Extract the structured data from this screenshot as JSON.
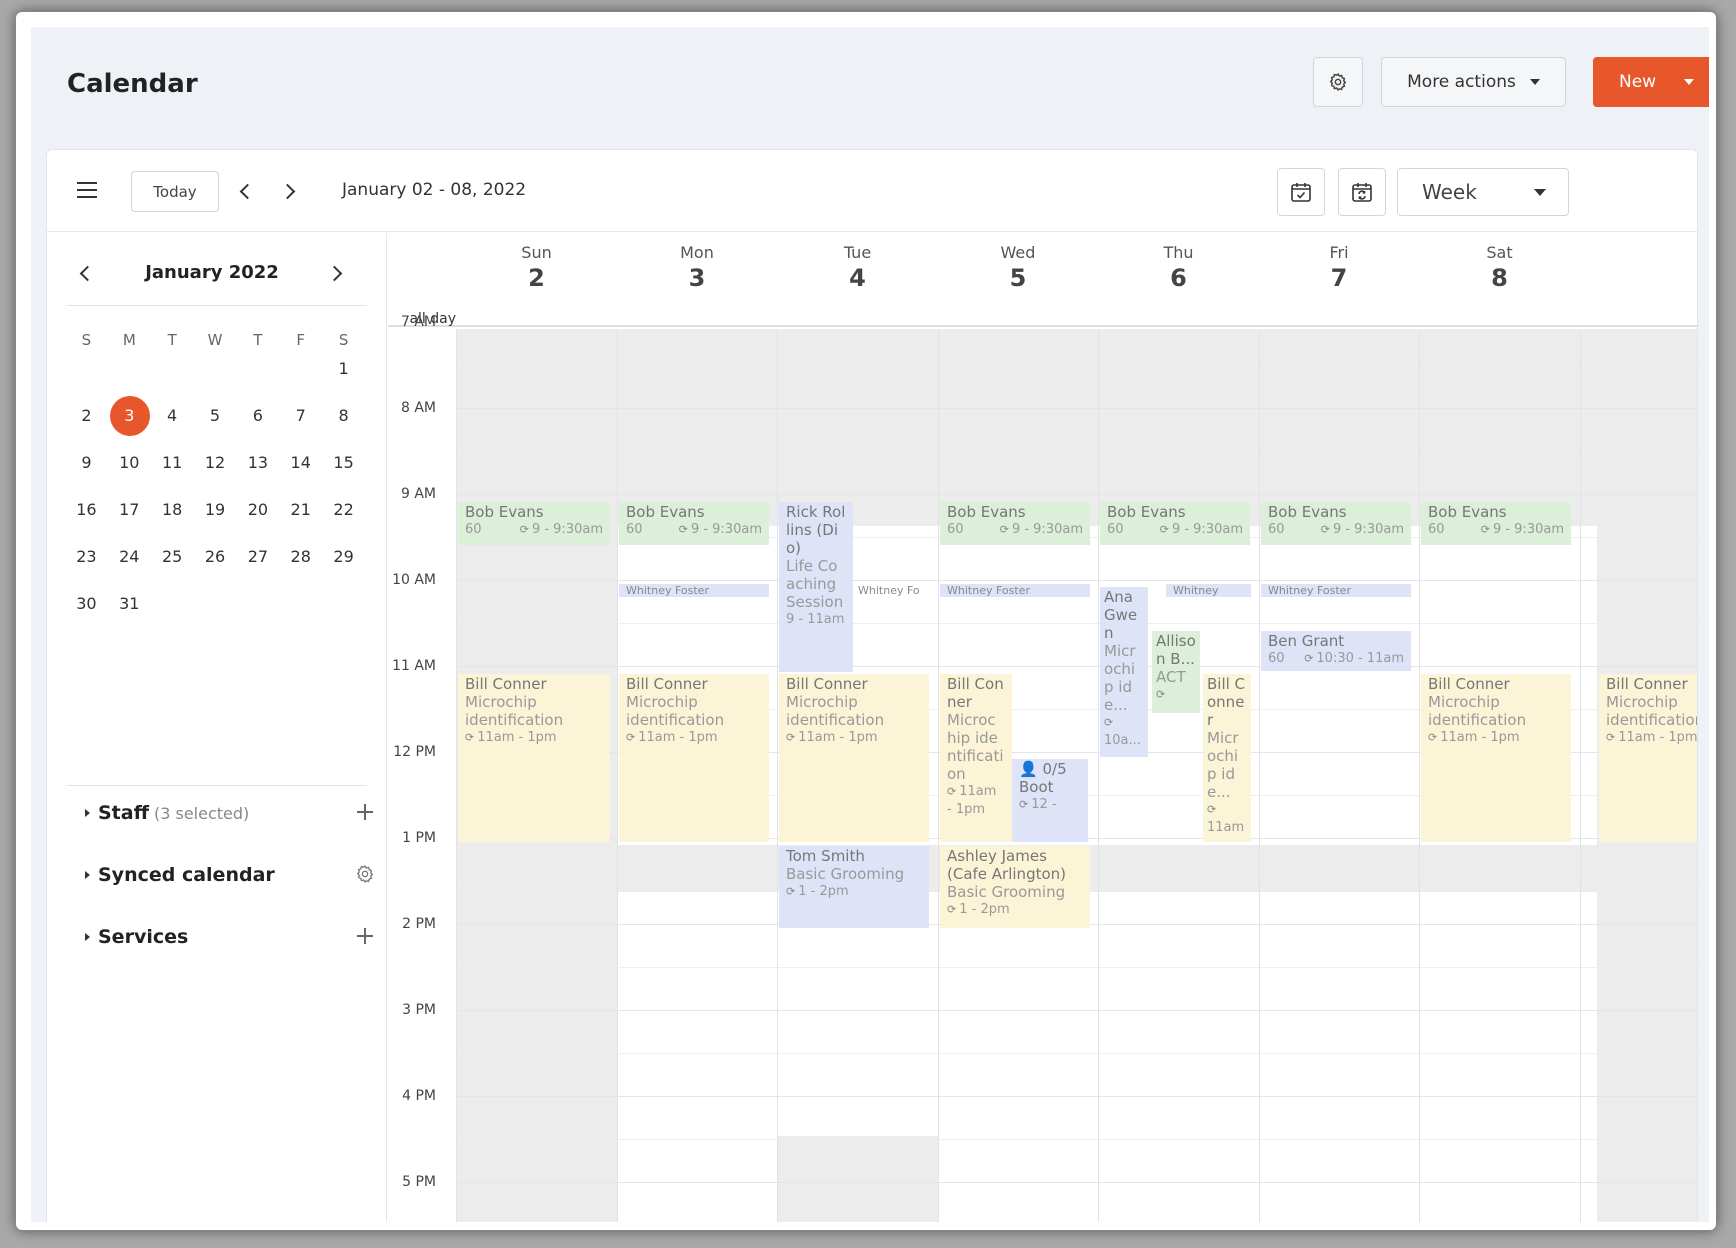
{
  "header": {
    "title": "Calendar",
    "more_actions_label": "More actions",
    "new_label": "New"
  },
  "toolbar": {
    "today_label": "Today",
    "range": "January 02 - 08, 2022",
    "view_label": "Week"
  },
  "mini_calendar": {
    "title": "January 2022",
    "weekdays": [
      "S",
      "M",
      "T",
      "W",
      "T",
      "F",
      "S"
    ],
    "weeks": [
      [
        "",
        "",
        "",
        "",
        "",
        "",
        "1"
      ],
      [
        "2",
        "3",
        "4",
        "5",
        "6",
        "7",
        "8"
      ],
      [
        "9",
        "10",
        "11",
        "12",
        "13",
        "14",
        "15"
      ],
      [
        "16",
        "17",
        "18",
        "19",
        "20",
        "21",
        "22"
      ],
      [
        "23",
        "24",
        "25",
        "26",
        "27",
        "28",
        "29"
      ],
      [
        "30",
        "31",
        "",
        "",
        "",
        "",
        ""
      ]
    ],
    "selected_day": "3"
  },
  "sidebar": {
    "sections": [
      {
        "name": "Staff",
        "sub": "(3 selected)",
        "action": "plus-icon"
      },
      {
        "name": "Synced calendar",
        "sub": "",
        "action": "gear-icon"
      },
      {
        "name": "Services",
        "sub": "",
        "action": "plus-icon"
      }
    ]
  },
  "week": {
    "all_day_label": "all day",
    "days": [
      {
        "name": "Sun",
        "date": "2"
      },
      {
        "name": "Mon",
        "date": "3"
      },
      {
        "name": "Tue",
        "date": "4"
      },
      {
        "name": "Wed",
        "date": "5"
      },
      {
        "name": "Thu",
        "date": "6"
      },
      {
        "name": "Fri",
        "date": "7"
      },
      {
        "name": "Sat",
        "date": "8"
      }
    ],
    "hours": [
      "7 AM",
      "8 AM",
      "9 AM",
      "10 AM",
      "11 AM",
      "12 PM",
      "1 PM",
      "2 PM",
      "3 PM",
      "4 PM",
      "5 PM"
    ]
  },
  "events": {
    "bob_name": "Bob Evans",
    "bob_dur": "60",
    "bob_time": "9 - 9:30am",
    "whitney": "Whitney Foster",
    "whitney_cut": "Whitney Fo",
    "bill_name": "Bill Conner",
    "bill_svc": "Microchip identification",
    "bill_time": "11am - 1pm",
    "rick_name": "Rick Rollins (Dio)",
    "rick_svc": "Life Coaching Session",
    "rick_time": "9 - 11am",
    "tom_name": "Tom Smith",
    "tom_svc": "Basic Grooming",
    "tom_time": "1 - 2pm",
    "ashley_name": "Ashley James (Cafe Arlington)",
    "ashley_svc": "Basic Grooming",
    "ashley_time": "1 - 2pm",
    "wed_bill_time": "11am - 1pm",
    "boot_count": "0/5",
    "boot_name": "Boot",
    "boot_time": "12 -",
    "ana_name": "Ana Gwen",
    "ana_svc": "Microchip ide...",
    "ana_time": "10a...",
    "allison_name": "Allison B...",
    "allison_svc": "ACT",
    "thu_bill_svc": "Microchip ide...",
    "thu_bill_time": "11am ...",
    "ben_name": "Ben Grant",
    "ben_dur": "60",
    "ben_time": "10:30 - 11am"
  },
  "colors": {
    "accent": "#e8562c",
    "event_green": "#dcefd9",
    "event_yellow": "#fbf4d6",
    "event_blue": "#dfe3f7",
    "unavailable": "#ececec"
  }
}
